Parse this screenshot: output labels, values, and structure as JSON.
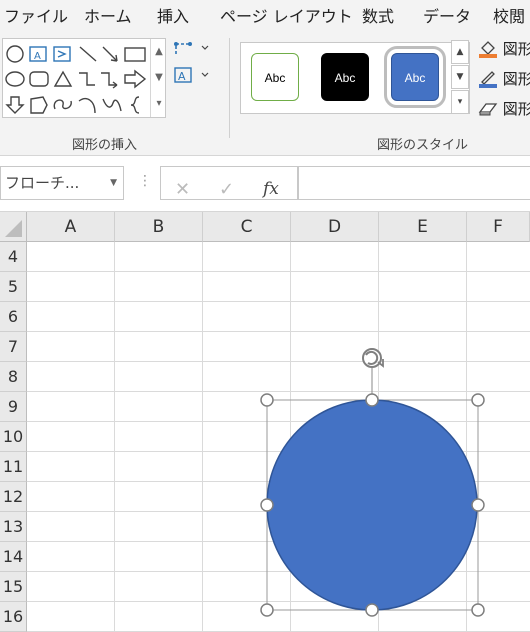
{
  "menu": {
    "tabs": [
      "ファイル",
      "ホーム",
      "挿入",
      "ページ レイアウト",
      "数式",
      "データ",
      "校閲"
    ]
  },
  "ribbon": {
    "insert_shapes_label": "図形の挿入",
    "shape_styles_label": "図形のスタイル",
    "style_presets": [
      {
        "text": "Abc",
        "bg": "#ffffff",
        "border": "#70ad47",
        "color": "#000000"
      },
      {
        "text": "Abc",
        "bg": "#000000",
        "border": "#000000",
        "color": "#ffffff"
      },
      {
        "text": "Abc",
        "bg": "#4472c4",
        "border": "#2f5597",
        "color": "#ffffff"
      }
    ],
    "right_items": [
      "図形",
      "図形",
      "図形"
    ]
  },
  "formula_bar": {
    "namebox_value": "フローチ...",
    "cancel_symbol": "✕",
    "confirm_symbol": "✓",
    "fx_symbol": "fx",
    "formula_value": ""
  },
  "sheet": {
    "columns": [
      "A",
      "B",
      "C",
      "D",
      "E",
      "F"
    ],
    "rows": [
      "4",
      "5",
      "6",
      "7",
      "8",
      "9",
      "10",
      "11",
      "12",
      "13",
      "14",
      "15",
      "16"
    ]
  },
  "shape": {
    "type": "oval",
    "fill": "#4472c4",
    "outline": "#2f5597",
    "selected": true
  },
  "colors": {
    "ribbon_bg": "#f3f3f3",
    "header_bg": "#e9e9e9",
    "gridline": "#dadada",
    "accent_orange": "#ed7d31",
    "accent_blue": "#4472c4"
  }
}
